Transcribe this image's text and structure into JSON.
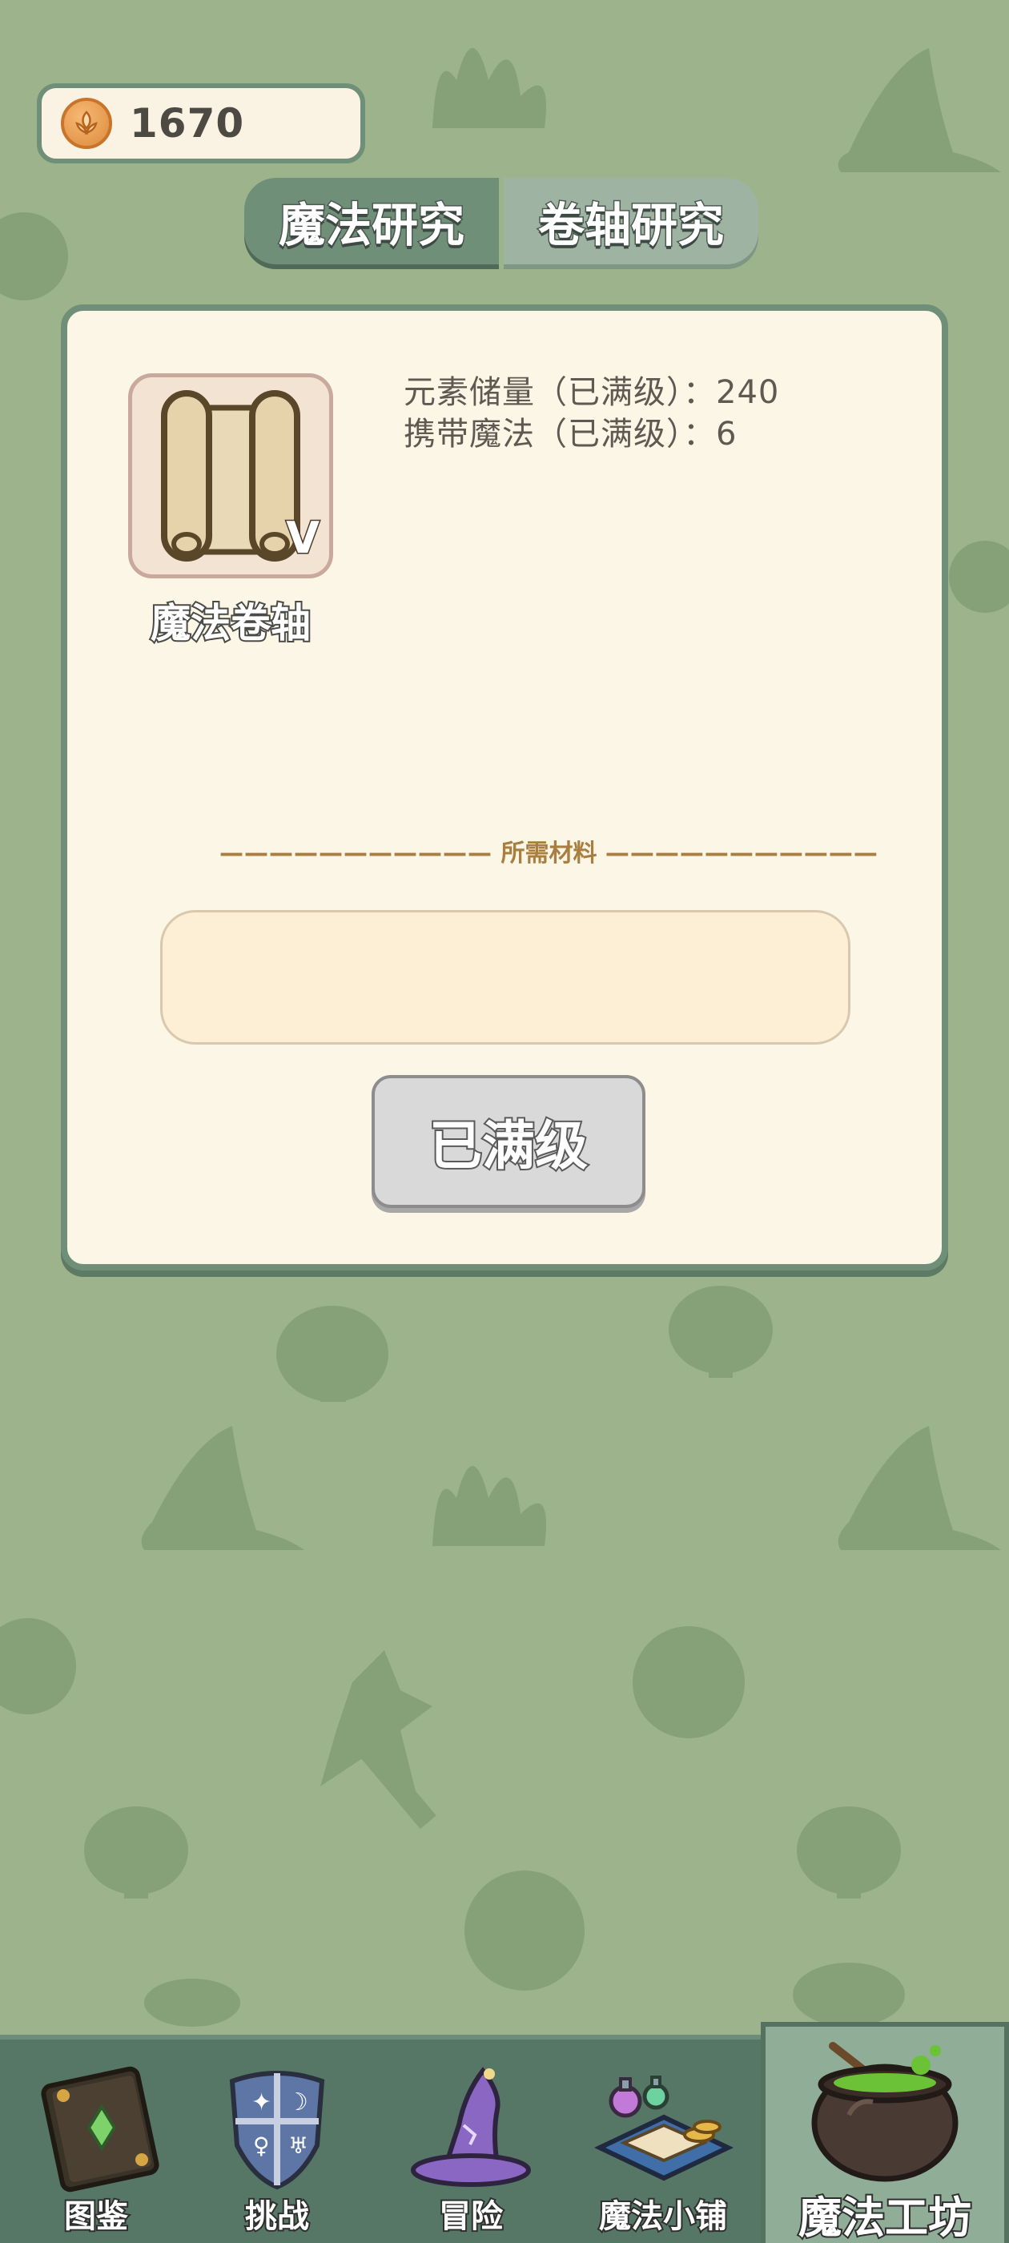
{
  "currency": {
    "icon": "wheat-coin-icon",
    "amount": "1670"
  },
  "tabs": [
    {
      "label": "魔法研究",
      "active": true
    },
    {
      "label": "卷轴研究",
      "active": false
    }
  ],
  "item": {
    "name": "魔法卷轴",
    "level_badge": "V",
    "icon": "scroll-icon",
    "stats": [
      "元素储量（已满级）：240",
      "携带魔法（已满级）：6"
    ]
  },
  "materials": {
    "header": "所需材料",
    "dashes": "———————————"
  },
  "action_button": {
    "label": "已满级",
    "enabled": false
  },
  "nav": [
    {
      "label": "图鉴",
      "icon": "book-icon"
    },
    {
      "label": "挑战",
      "icon": "shield-icon"
    },
    {
      "label": "冒险",
      "icon": "wizard-hat-icon"
    },
    {
      "label": "魔法小铺",
      "icon": "shop-potions-icon"
    },
    {
      "label": "魔法工坊",
      "icon": "cauldron-icon",
      "active": true
    }
  ],
  "colors": {
    "background": "#9db38c",
    "panel": "#fcf6e7",
    "accent": "#6f8f78",
    "nav": "#567765"
  }
}
